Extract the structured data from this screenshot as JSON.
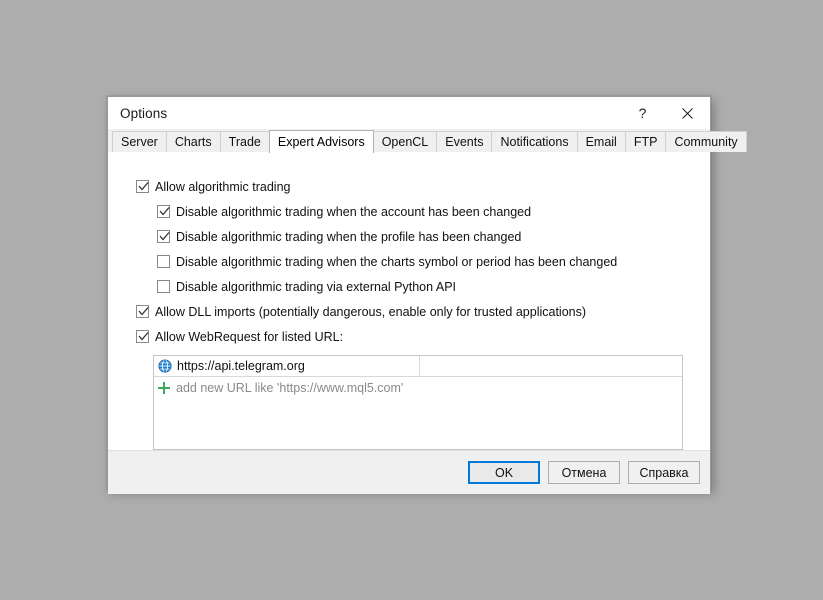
{
  "window": {
    "title": "Options",
    "help_icon": "question-mark-icon",
    "help_label": "?",
    "close_icon": "close-icon",
    "close_label": "✕"
  },
  "tabs": [
    {
      "label": "Server",
      "active": false
    },
    {
      "label": "Charts",
      "active": false
    },
    {
      "label": "Trade",
      "active": false
    },
    {
      "label": "Expert Advisors",
      "active": true
    },
    {
      "label": "OpenCL",
      "active": false
    },
    {
      "label": "Events",
      "active": false
    },
    {
      "label": "Notifications",
      "active": false
    },
    {
      "label": "Email",
      "active": false
    },
    {
      "label": "FTP",
      "active": false
    },
    {
      "label": "Community",
      "active": false
    }
  ],
  "options": {
    "allow_algo": {
      "label": "Allow algorithmic trading",
      "checked": true
    },
    "disable_account": {
      "label": "Disable algorithmic trading when the account has been changed",
      "checked": true
    },
    "disable_profile": {
      "label": "Disable algorithmic trading when the profile has been changed",
      "checked": true
    },
    "disable_charts": {
      "label": "Disable algorithmic trading when the charts symbol or period has been changed",
      "checked": false
    },
    "disable_python": {
      "label": "Disable algorithmic trading via external Python API",
      "checked": false
    },
    "allow_dll": {
      "label": "Allow DLL imports (potentially dangerous, enable only for trusted applications)",
      "checked": true
    },
    "allow_webrequest": {
      "label": "Allow WebRequest for listed URL:",
      "checked": true
    }
  },
  "url_list": {
    "entries": [
      {
        "icon": "globe-icon",
        "url": "https://api.telegram.org"
      }
    ],
    "add_row": {
      "icon": "plus-icon",
      "label": "add new URL like 'https://www.mql5.com'"
    }
  },
  "footer": {
    "ok_label": "OK",
    "cancel_label": "Отмена",
    "help_label": "Справка"
  },
  "colors": {
    "accent": "#0078d7",
    "desktop": "#adadad",
    "globe": "#1a7fd4",
    "plus": "#3faa5a"
  }
}
